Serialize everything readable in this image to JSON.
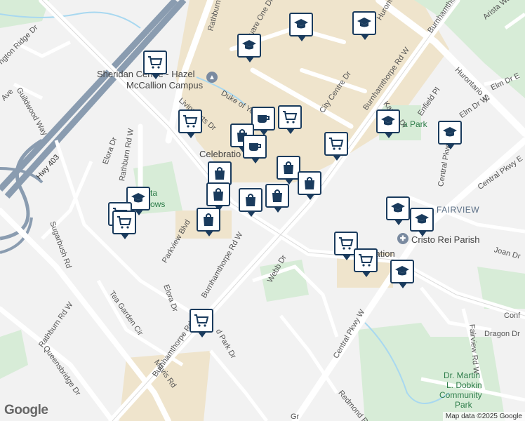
{
  "map": {
    "attribution": "Map data ©2025 Google",
    "logo": "Google"
  },
  "places": {
    "sheridan_1": "Sheridan Centre - Hazel",
    "sheridan_2": "McCallion Campus",
    "celebration": "Celebratio",
    "celebration_2": "cation",
    "fairview": "FAIRVIEW",
    "cristo_rei": "Cristo Rei Parish",
    "park_a": "a Park",
    "park_b": "ta",
    "park_c": "ows",
    "dobkin_1": "Dr. Martin",
    "dobkin_2": "L. Dobkin",
    "dobkin_3": "Community",
    "dobkin_4": "Park"
  },
  "streets": {
    "rathburn_top": "Rathburn Rd",
    "square_one": "Square One Dr",
    "hurontario_top": "Hurontario St",
    "burnhamthorpe_ne": "Burnhamthorpe Rd W",
    "burnhamthorpe_e": "Burnhamthorpe",
    "arista": "Arista Way",
    "hurontario_e": "Hurontario St",
    "elm": "Elm Dr E",
    "duke_of_york": "Duke of York",
    "city_centre": "City Centre Dr",
    "kariya": "Kariya Dr",
    "enfield": "Enfield Pl",
    "elm_w": "Elm Dr W",
    "central_pkwy_e": "Central Pkwy E",
    "central_pkwy_w": "Central Pkwy W",
    "central_pkwy_w2": "Central Pkwy W",
    "living_arts": "Living Arts Dr",
    "rathburn_w": "Rathburn Rd W",
    "elora_top": "Elora Dr",
    "elora_bottom": "Elora Dr",
    "hwy403": "Hwy 403",
    "glen_erin": "ngton Ridge Dr",
    "guildwood": "Guildwood Way",
    "ave": "Ave",
    "parkview": "Parkview Blvd",
    "burnhamthorpe_sw": "Burnhamthorpe Rd W",
    "burnhamthorpe_sw2": "Burnhamthorpe Rd W",
    "sugarbush": "Sugarbush Rd",
    "tea_garden": "Tea Garden Cir",
    "rathburn_sw": "Rathburn Rd W",
    "queensbridge": "Queensbridge Dr",
    "mavis": "Mavis Rd",
    "webb": "Webb Dr",
    "park_dr": "d Park Dr",
    "redmond": "Redmond Rd",
    "joan": "Joan Dr",
    "conf": "Conf",
    "dragon": "Dragon Dr",
    "fairview_rd": "Fairview Rd W",
    "gr": "Gr"
  },
  "markers": [
    {
      "type": "school-icon"
    },
    {
      "type": "school-icon"
    },
    {
      "type": "school-icon"
    },
    {
      "type": "shopping-cart-icon"
    },
    {
      "type": "shopping-cart-icon"
    },
    {
      "type": "cafe-icon"
    },
    {
      "type": "shopping-cart-icon"
    },
    {
      "type": "shopping-bag-icon"
    },
    {
      "type": "cafe-icon"
    },
    {
      "type": "shopping-cart-icon"
    },
    {
      "type": "school-icon"
    },
    {
      "type": "school-icon"
    },
    {
      "type": "shopping-bag-icon"
    },
    {
      "type": "shopping-bag-icon"
    },
    {
      "type": "shopping-bag-icon"
    },
    {
      "type": "shopping-bag-icon"
    },
    {
      "type": "shopping-bag-icon"
    },
    {
      "type": "shopping-bag-icon"
    },
    {
      "type": "school-icon"
    },
    {
      "type": "shopping-cart-icon"
    },
    {
      "type": "shopping-cart-icon"
    },
    {
      "type": "shopping-bag-icon"
    },
    {
      "type": "school-icon"
    },
    {
      "type": "school-icon"
    },
    {
      "type": "shopping-cart-icon"
    },
    {
      "type": "shopping-cart-icon"
    },
    {
      "type": "school-icon"
    },
    {
      "type": "shopping-cart-icon"
    }
  ],
  "colors": {
    "pin_border": "#1a3b5d",
    "road": "#ffffff",
    "highway": "#8a9cb0",
    "park": "#cfe8cf",
    "commercial": "#efe4cc",
    "background": "#f2f2f2"
  }
}
